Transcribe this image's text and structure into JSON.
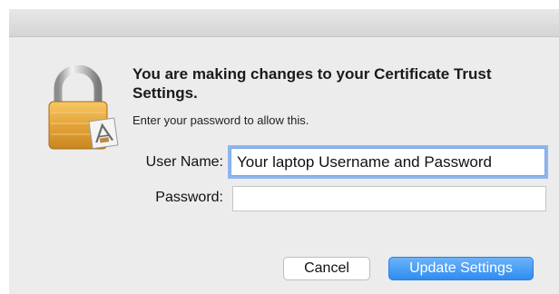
{
  "dialog": {
    "heading": "You are making changes to your Certificate Trust Settings.",
    "subtext": "Enter your password to allow this."
  },
  "form": {
    "username_label": "User Name:",
    "username_value": "Your laptop Username and Password",
    "password_label": "Password:",
    "password_value": ""
  },
  "buttons": {
    "cancel_label": "Cancel",
    "update_label": "Update Settings"
  },
  "icons": {
    "lock": "lock-icon"
  },
  "colors": {
    "accent": "#2f8cf0",
    "focus_ring": "#8db6ee",
    "lock_gold": "#e4a43a"
  }
}
